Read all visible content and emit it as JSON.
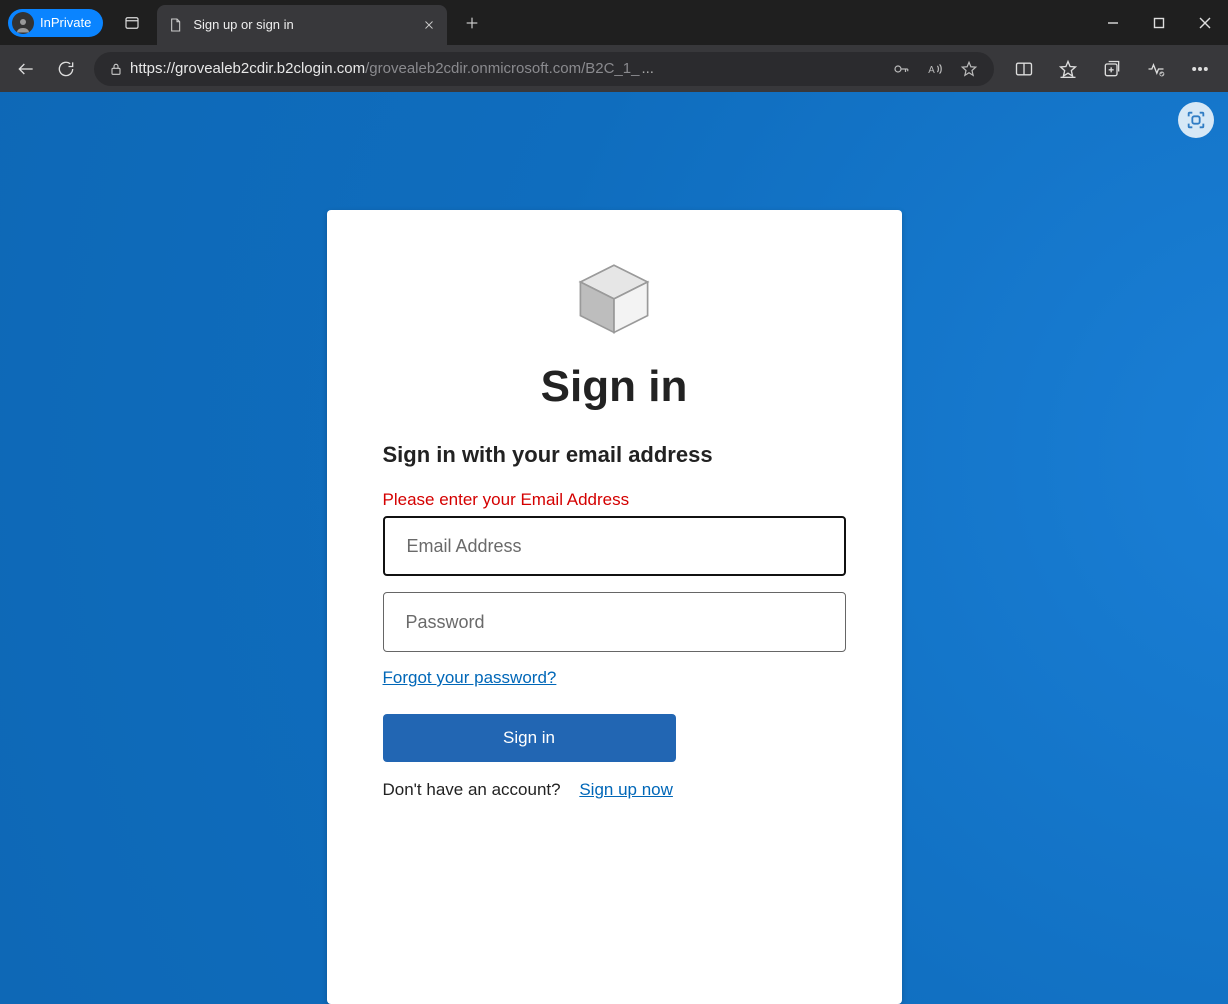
{
  "browser": {
    "inprivate_label": "InPrivate",
    "tab_title": "Sign up or sign in",
    "url_host": "https://grovealeb2cdir.b2clogin.com",
    "url_path": "/grovealeb2cdir.onmicrosoft.com/B2C_1_",
    "url_ellipsis": "..."
  },
  "signin": {
    "heading": "Sign in",
    "subheading": "Sign in with your email address",
    "error_message": "Please enter your Email Address",
    "email_placeholder": "Email Address",
    "email_value": "",
    "password_placeholder": "Password",
    "password_value": "",
    "forgot_link": "Forgot your password?",
    "submit_label": "Sign in",
    "signup_prompt": "Don't have an account?",
    "signup_link": "Sign up now"
  }
}
